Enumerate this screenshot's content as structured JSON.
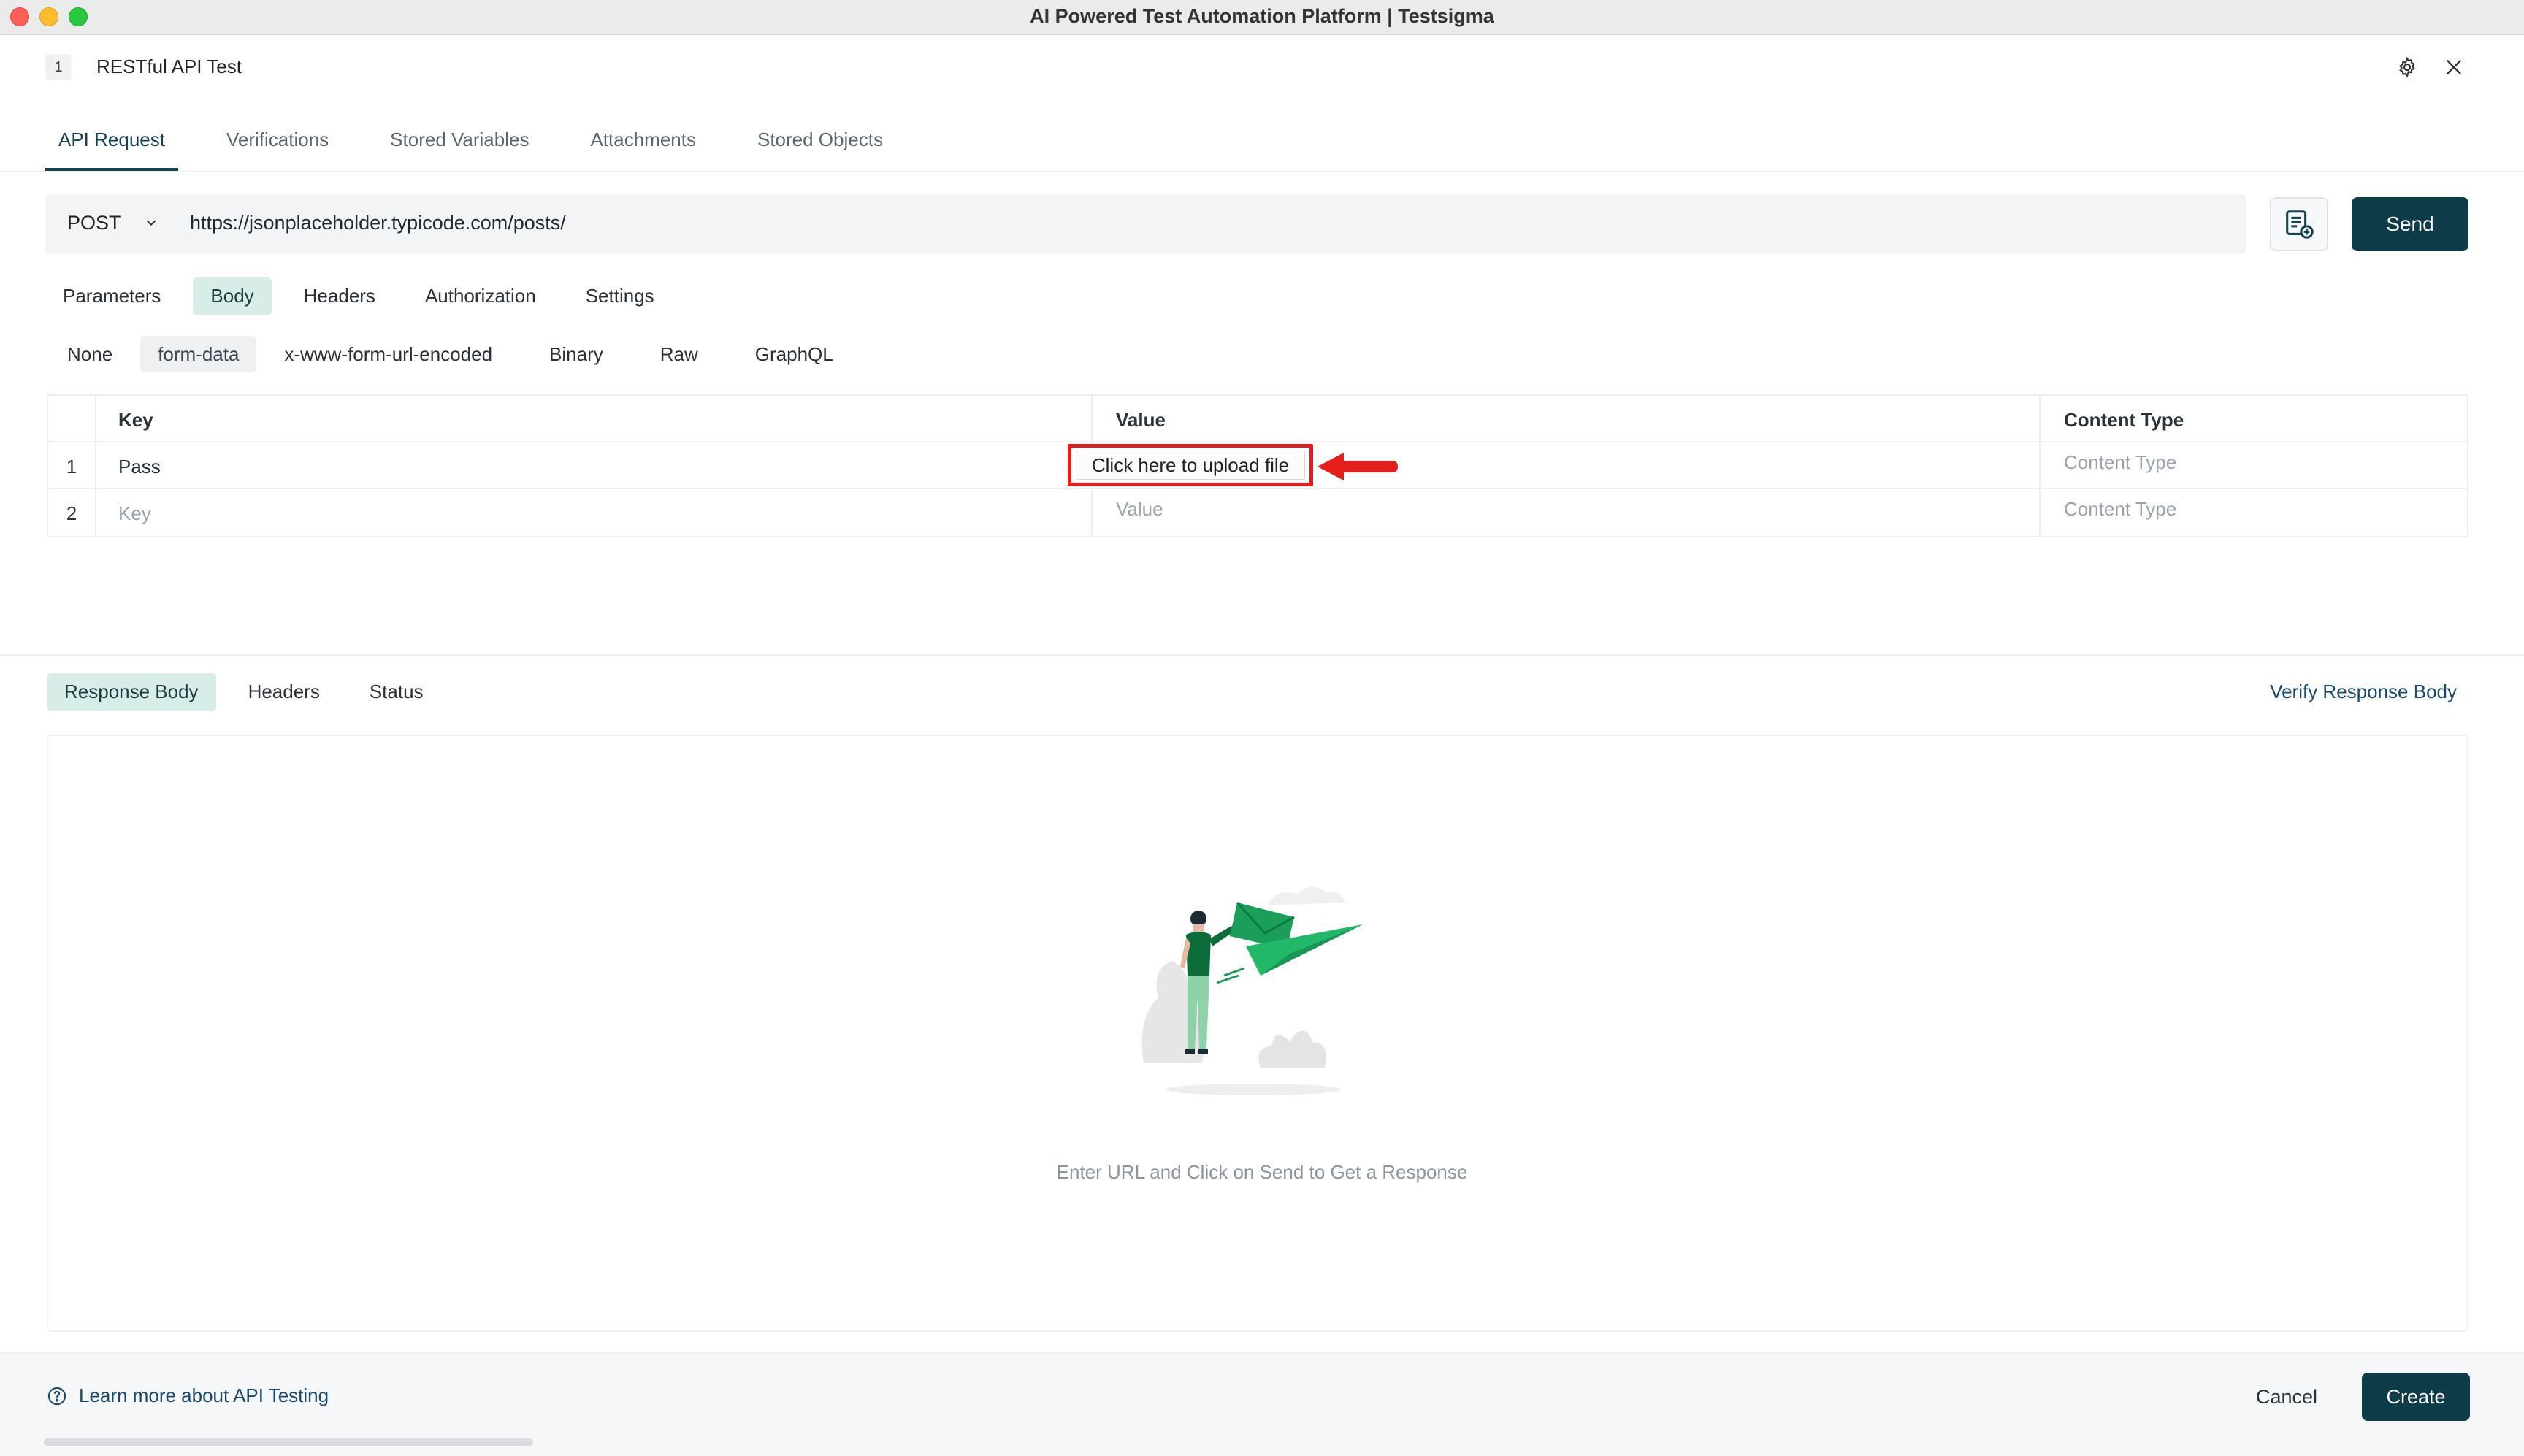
{
  "window": {
    "title": "AI Powered Test Automation Platform | Testsigma"
  },
  "header": {
    "step_number": "1",
    "title": "RESTful API Test"
  },
  "top_tabs": [
    {
      "label": "API Request",
      "active": true
    },
    {
      "label": "Verifications",
      "active": false
    },
    {
      "label": "Stored Variables",
      "active": false
    },
    {
      "label": "Attachments",
      "active": false
    },
    {
      "label": "Stored Objects",
      "active": false
    }
  ],
  "request": {
    "method": "POST",
    "url": "https://jsonplaceholder.typicode.com/posts/",
    "send_label": "Send"
  },
  "request_tabs": [
    {
      "label": "Parameters",
      "active": false
    },
    {
      "label": "Body",
      "active": true
    },
    {
      "label": "Headers",
      "active": false
    },
    {
      "label": "Authorization",
      "active": false
    },
    {
      "label": "Settings",
      "active": false
    }
  ],
  "body_types": [
    {
      "label": "None",
      "active": false
    },
    {
      "label": "form-data",
      "active": true
    },
    {
      "label": "x-www-form-url-encoded",
      "active": false
    },
    {
      "label": "Binary",
      "active": false
    },
    {
      "label": "Raw",
      "active": false
    },
    {
      "label": "GraphQL",
      "active": false
    }
  ],
  "form_table": {
    "headers": {
      "key": "Key",
      "value": "Value",
      "content_type": "Content Type"
    },
    "rows": [
      {
        "num": "1",
        "key": "Pass",
        "value": "Click here to upload file",
        "content_type_placeholder": "Content Type"
      },
      {
        "num": "2",
        "key_placeholder": "Key",
        "value_placeholder": "Value",
        "content_type_placeholder": "Content Type"
      }
    ]
  },
  "response_tabs": [
    {
      "label": "Response Body",
      "active": true
    },
    {
      "label": "Headers",
      "active": false
    },
    {
      "label": "Status",
      "active": false
    }
  ],
  "response": {
    "verify_link": "Verify Response Body",
    "empty_message": "Enter URL and Click on Send to Get a Response"
  },
  "footer": {
    "learn_more": "Learn more about API Testing",
    "cancel_label": "Cancel",
    "create_label": "Create"
  },
  "colors": {
    "primary": "#0d3b48",
    "active_pill": "#d8ece8",
    "highlight_red": "#e41d1d",
    "illustration_green": "#1b9e5a"
  }
}
